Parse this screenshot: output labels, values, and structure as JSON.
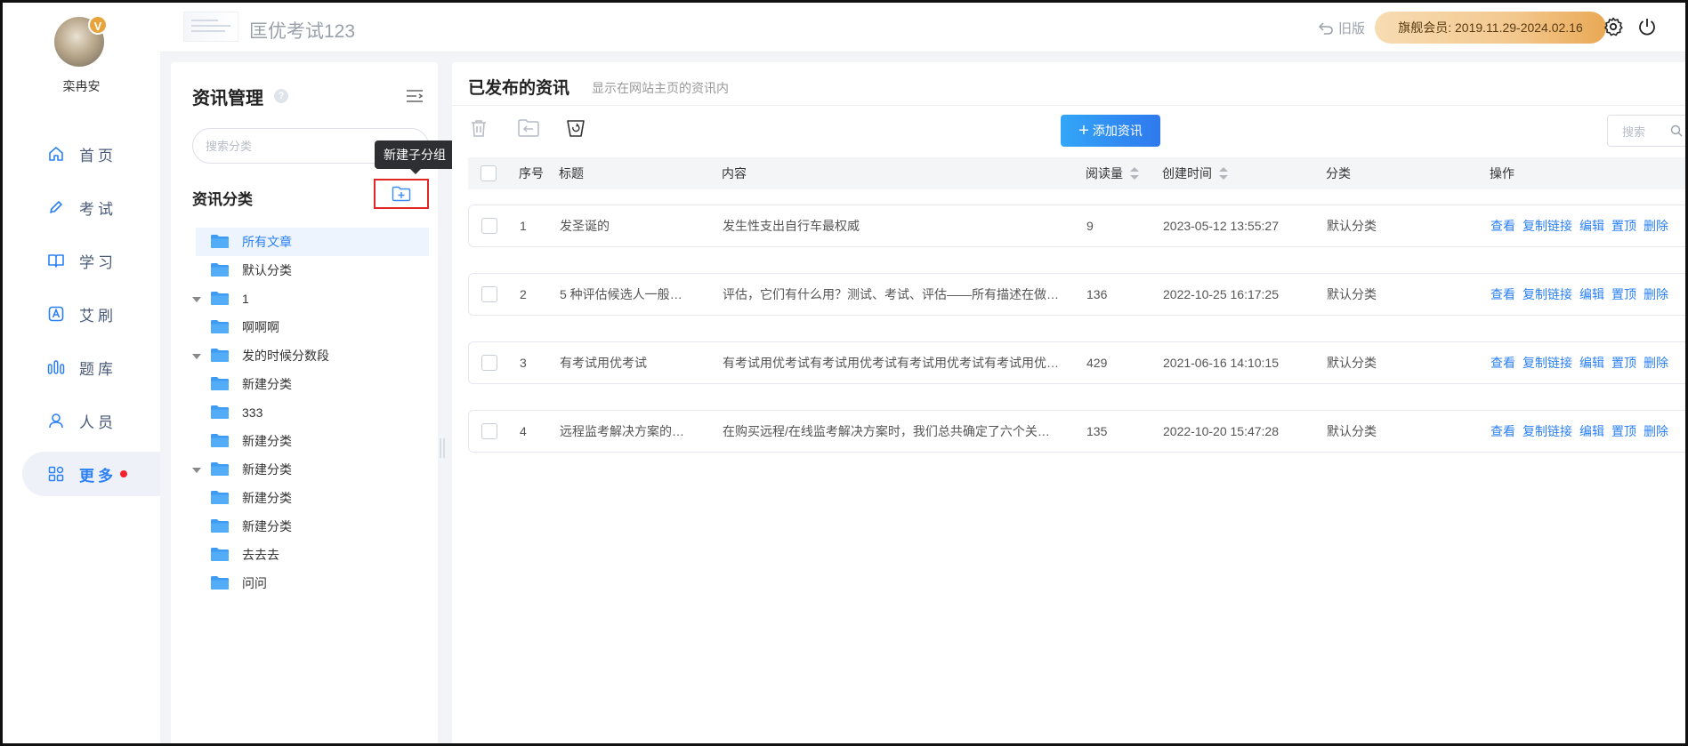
{
  "user": {
    "name": "栾冉安",
    "badge": "V"
  },
  "nav": [
    {
      "label": "首页",
      "icon": "home-icon"
    },
    {
      "label": "考试",
      "icon": "pen-icon"
    },
    {
      "label": "学习",
      "icon": "book-icon"
    },
    {
      "label": "艾刷",
      "icon": "a-box-icon"
    },
    {
      "label": "题库",
      "icon": "bar-chart-icon"
    },
    {
      "label": "人员",
      "icon": "person-icon"
    },
    {
      "label": "更多",
      "icon": "grid-icon",
      "active": true
    }
  ],
  "header": {
    "title": "匡优考试123",
    "old_version": "旧版",
    "member": "旗舰会员: 2019.11.29-2024.02.16"
  },
  "category_panel": {
    "title": "资讯管理",
    "search_placeholder": "搜索分类",
    "subtitle": "资讯分类",
    "tooltip": "新建子分组",
    "tree": [
      {
        "label": "所有文章",
        "level": 0,
        "active": true
      },
      {
        "label": "默认分类",
        "level": 0
      },
      {
        "label": "1",
        "level": 0,
        "expanded": true
      },
      {
        "label": "啊啊啊",
        "level": 1
      },
      {
        "label": "发的时候分数段",
        "level": 0,
        "expanded": true
      },
      {
        "label": "新建分类",
        "level": 1
      },
      {
        "label": "333",
        "level": 1
      },
      {
        "label": "新建分类",
        "level": 1
      },
      {
        "label": "新建分类",
        "level": 0,
        "expanded": true
      },
      {
        "label": "新建分类",
        "level": 1
      },
      {
        "label": "新建分类",
        "level": 1
      },
      {
        "label": "去去去",
        "level": 1
      },
      {
        "label": "问问",
        "level": 1
      }
    ]
  },
  "main": {
    "title": "已发布的资讯",
    "subtitle": "显示在网站主页的资讯内",
    "add_button": "添加资讯",
    "search_placeholder": "搜索",
    "columns": {
      "index": "序号",
      "title": "标题",
      "content": "内容",
      "reads": "阅读量",
      "created": "创建时间",
      "category": "分类",
      "actions": "操作"
    },
    "rows": [
      {
        "index": "1",
        "title": "发圣诞的",
        "content": "发生性支出自行车最权威",
        "reads": "9",
        "created": "2023-05-12 13:55:27",
        "category": "默认分类"
      },
      {
        "index": "2",
        "title": "5 种评估候选人一般认…",
        "content": "评估，它们有什么用？测试、考试、评估——所有描述在做…",
        "reads": "136",
        "created": "2022-10-25 16:17:25",
        "category": "默认分类"
      },
      {
        "index": "3",
        "title": "有考试用优考试",
        "content": "有考试用优考试有考试用优考试有考试用优考试有考试用优…",
        "reads": "429",
        "created": "2021-06-16 14:10:15",
        "category": "默认分类"
      },
      {
        "index": "4",
        "title": "远程监考解决方案的…",
        "content": "在购买远程/在线监考解决方案时，我们总共确定了六个关…",
        "reads": "135",
        "created": "2022-10-20 15:47:28",
        "category": "默认分类"
      }
    ],
    "actions": [
      "查看",
      "复制链接",
      "编辑",
      "置顶",
      "删除"
    ]
  },
  "colors": {
    "accent": "#2b80f5",
    "highlight_box": "#e22525",
    "member_gold": "#f3c88f"
  }
}
